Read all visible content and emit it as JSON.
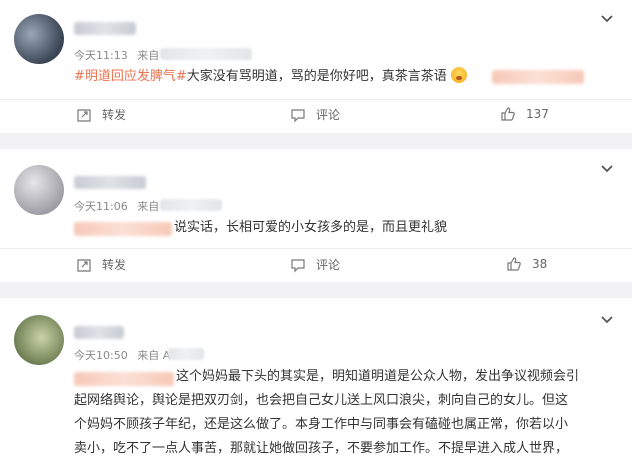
{
  "posts": [
    {
      "time": "今天11:13",
      "from_label": "来自",
      "hashtag": "#明道回应发脾气#",
      "text": "大家没有骂明道，骂的是你好吧，真茶言茶语",
      "actions": {
        "repost": "转发",
        "comment": "评论",
        "like_count": "137"
      }
    },
    {
      "time": "今天11:06",
      "from_label": "来自",
      "text": "说实话，长相可爱的小女孩多的是，而且更礼貌",
      "actions": {
        "repost": "转发",
        "comment": "评论",
        "like_count": "38"
      }
    },
    {
      "time": "今天10:50",
      "from_label": "来自",
      "from_partial": "A",
      "lines": [
        "这个妈妈最下头的其实是，明知道明道是公众人物，发出争议视频会引",
        "起网络舆论，舆论是把双刃剑，也会把自己女儿送上风口浪尖，刺向自己的女儿。但这",
        "个妈妈不顾孩子年纪，还是这么做了。本身工作中与同事会有磕碰也属正常，你若以小",
        "卖小，吃不了一点人事苦，那就让她做回孩子，不要参加工作。不提早进入成人世界，"
      ]
    }
  ],
  "colors": {
    "hashtag": "#eb7350",
    "background": "#f2f2f5"
  },
  "icons": [
    "chevron-down-icon",
    "repost-icon",
    "comment-icon",
    "like-icon",
    "emoji-icon"
  ]
}
